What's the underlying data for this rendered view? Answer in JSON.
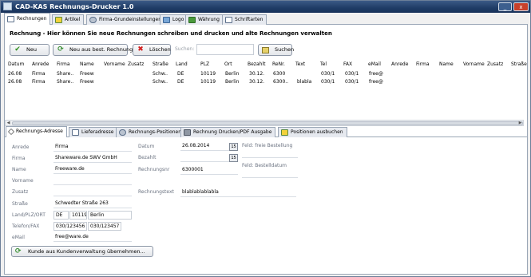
{
  "window": {
    "title": "CAD-KAS Rechnungs-Drucker 1.0",
    "minimize_glyph": "_",
    "close_glyph": "x"
  },
  "main_tabs": [
    {
      "label": "Rechnungen",
      "icon": "document-icon"
    },
    {
      "label": "Artikel",
      "icon": "star-icon"
    },
    {
      "label": "Firma-Grundeinstellungen",
      "icon": "gear-icon"
    },
    {
      "label": "Logo",
      "icon": "image-icon"
    },
    {
      "label": "Währung",
      "icon": "money-icon"
    },
    {
      "label": "Schriftarten",
      "icon": "font-icon"
    }
  ],
  "heading": "Rechnung - Hier können Sie neue Rechnungen schreiben und drucken und alte Rechnungen verwalten",
  "toolbar": {
    "new_label": "Neu",
    "new_from_existing_label": "Neu aus best. Rechnung",
    "delete_label": "Löschen",
    "search_label": "Suchen:",
    "search_value": "",
    "search_button_label": "Suchen"
  },
  "table": {
    "columns": [
      "Datum",
      "Anrede",
      "Firma",
      "Name",
      "Vorname",
      "Zusatz",
      "Straße",
      "Land",
      "PLZ",
      "Ort",
      "Bezahlt",
      "ReNr.",
      "Text",
      "Tel",
      "FAX",
      "eMail",
      "Anrede",
      "Firma",
      "Name",
      "Vorname",
      "Zusatz",
      "Straße"
    ],
    "rows": [
      [
        "26.08",
        "Firma",
        "Share..",
        "Freew",
        "",
        "",
        "Schw..",
        "DE",
        "10119",
        "Berlin",
        "30.12.",
        "6300",
        "",
        "030/1",
        "030/1",
        "free@",
        "",
        "",
        "",
        "",
        "",
        ""
      ],
      [
        "26.08",
        "Firma",
        "Share..",
        "Freew",
        "",
        "",
        "Schw..",
        "DE",
        "10119",
        "Berlin",
        "30.12.",
        "6300..",
        "blabla",
        "030/1",
        "030/1",
        "free@",
        "",
        "",
        "",
        "",
        "",
        ""
      ]
    ]
  },
  "sub_tabs": [
    {
      "label": "Rechnungs-Adresse",
      "icon": "pen-icon"
    },
    {
      "label": "Lieferadresse",
      "icon": "document-icon"
    },
    {
      "label": "Rechnungs-Positionen",
      "icon": "gear-icon"
    },
    {
      "label": "Rechnung Drucken/PDF Ausgabe",
      "icon": "printer-icon"
    },
    {
      "label": "Positionen ausbuchen",
      "icon": "star-icon"
    }
  ],
  "address": {
    "anrede_label": "Anrede",
    "anrede_value": "Firma",
    "firma_label": "Firma",
    "firma_value": "Shareware.de SWV GmbH",
    "name_label": "Name",
    "name_value": "Freeware.de",
    "vorname_label": "Vorname",
    "vorname_value": "",
    "zusatz_label": "Zusatz",
    "zusatz_value": "",
    "strasse_label": "Straße",
    "strasse_value": "Schwedter Straße 263",
    "landplzort_label": "Land/PLZ/ORT",
    "land_value": "DE",
    "plz_value": "10119",
    "ort_value": "Berlin",
    "telefon_label": "Telefon/FAX",
    "telefon_value": "030/123456",
    "fax_value": "030/123457",
    "email_label": "eMail",
    "email_value": "free@ware.de"
  },
  "invoice": {
    "datum_label": "Datum",
    "datum_value": "26.08.2014",
    "bezahlt_label": "Bezahlt",
    "bezahlt_value": "",
    "rechnungsnr_label": "Rechnungsnr",
    "rechnungsnr_value": "6300001",
    "rechnungstext_label": "Rechnungstext",
    "rechnungstext_value": "blablablablabla",
    "freie_bestellung_label": "Feld: freie Bestellung",
    "bestelldatum_label": "Feld: Bestelldatum",
    "calendar_glyph": "15"
  },
  "kunde_button_label": "Kunde aus Kundenverwaltung übernehmen..."
}
